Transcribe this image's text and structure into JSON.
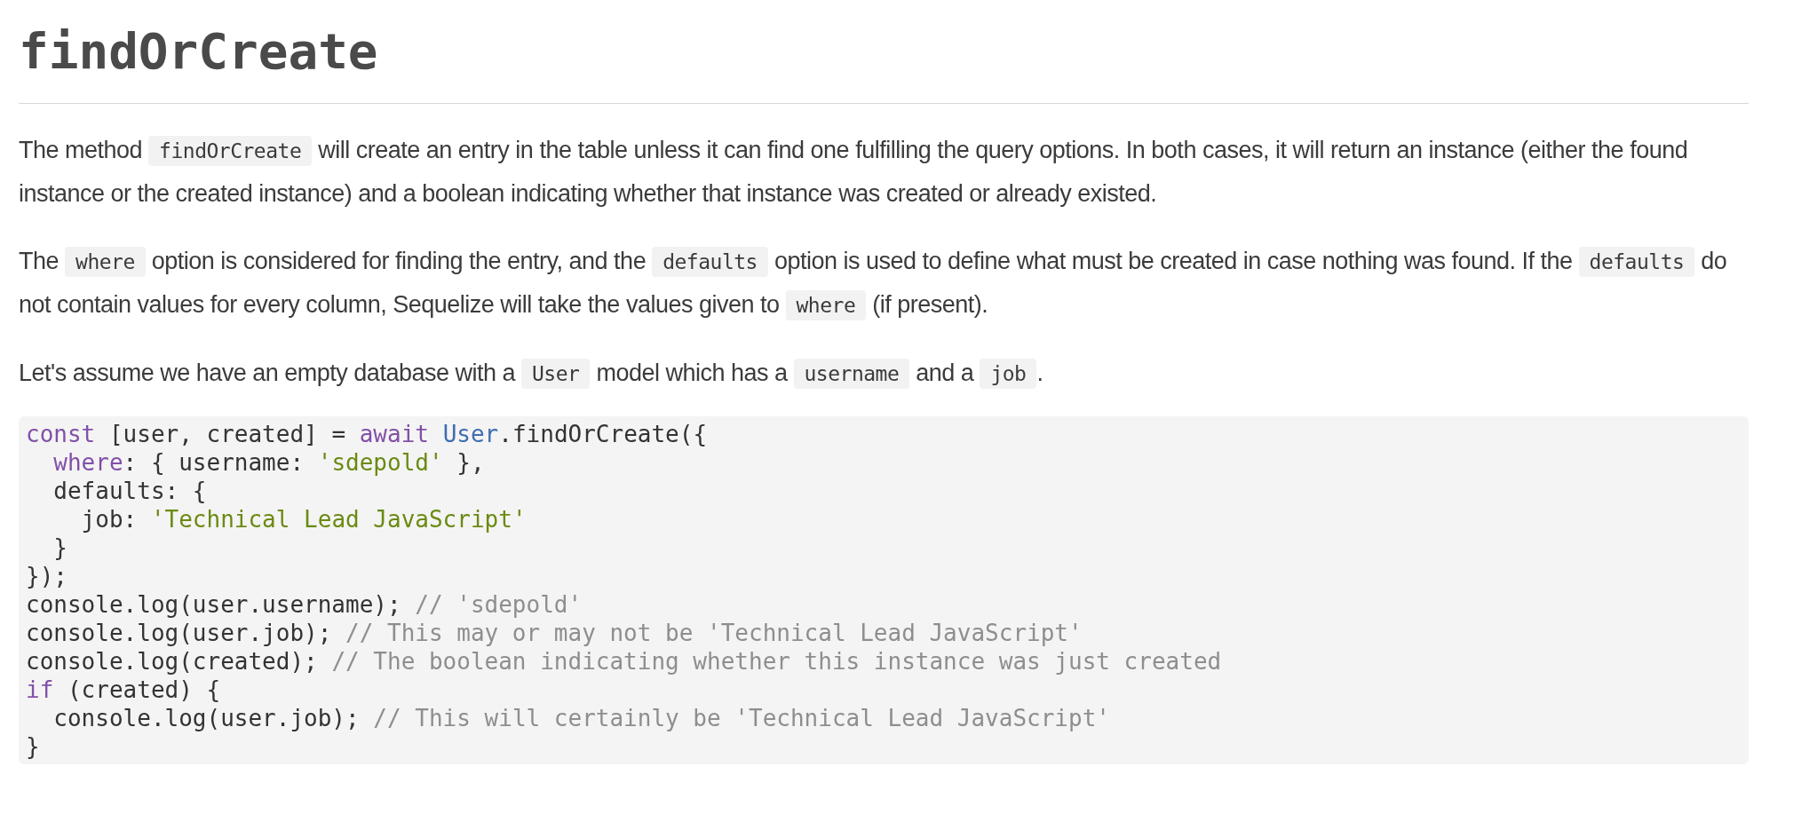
{
  "heading": "findOrCreate",
  "paragraphs": [
    [
      {
        "kind": "text",
        "text": "The method "
      },
      {
        "kind": "code",
        "text": "findOrCreate"
      },
      {
        "kind": "text",
        "text": " will create an entry in the table unless it can find one fulfilling the query options. In both cases, it will return an instance (either the found instance or the created instance) and a boolean indicating whether that instance was created or already existed."
      }
    ],
    [
      {
        "kind": "text",
        "text": "The "
      },
      {
        "kind": "code",
        "text": "where"
      },
      {
        "kind": "text",
        "text": " option is considered for finding the entry, and the "
      },
      {
        "kind": "code",
        "text": "defaults"
      },
      {
        "kind": "text",
        "text": " option is used to define what must be created in case nothing was found. If the "
      },
      {
        "kind": "code",
        "text": "defaults"
      },
      {
        "kind": "text",
        "text": " do not contain values for every column, Sequelize will take the values given to "
      },
      {
        "kind": "code",
        "text": "where"
      },
      {
        "kind": "text",
        "text": " (if present)."
      }
    ],
    [
      {
        "kind": "text",
        "text": "Let's assume we have an empty database with a "
      },
      {
        "kind": "code",
        "text": "User"
      },
      {
        "kind": "text",
        "text": " model which has a "
      },
      {
        "kind": "code",
        "text": "username"
      },
      {
        "kind": "text",
        "text": " and a "
      },
      {
        "kind": "code",
        "text": "job"
      },
      {
        "kind": "text",
        "text": "."
      }
    ]
  ],
  "code_lines": [
    [
      {
        "kind": "keyword",
        "text": "const"
      },
      {
        "kind": "plain",
        "text": " [user, created] = "
      },
      {
        "kind": "keyword",
        "text": "await"
      },
      {
        "kind": "class",
        "text": " User"
      },
      {
        "kind": "plain",
        "text": ".findOrCreate({"
      }
    ],
    [
      {
        "kind": "keyword",
        "text": "  where"
      },
      {
        "kind": "plain",
        "text": ": { username: "
      },
      {
        "kind": "string",
        "text": "'sdepold'"
      },
      {
        "kind": "plain",
        "text": " },"
      }
    ],
    [
      {
        "kind": "plain",
        "text": "  defaults: {"
      }
    ],
    [
      {
        "kind": "plain",
        "text": "    job: "
      },
      {
        "kind": "string",
        "text": "'Technical Lead JavaScript'"
      }
    ],
    [
      {
        "kind": "plain",
        "text": "  }"
      }
    ],
    [
      {
        "kind": "plain",
        "text": "});"
      }
    ],
    [
      {
        "kind": "plain",
        "text": "console.log(user.username); "
      },
      {
        "kind": "comment",
        "text": "// 'sdepold'"
      }
    ],
    [
      {
        "kind": "plain",
        "text": "console.log(user.job); "
      },
      {
        "kind": "comment",
        "text": "// This may or may not be 'Technical Lead JavaScript'"
      }
    ],
    [
      {
        "kind": "plain",
        "text": "console.log(created); "
      },
      {
        "kind": "comment",
        "text": "// The boolean indicating whether this instance was just created"
      }
    ],
    [
      {
        "kind": "keyword",
        "text": "if"
      },
      {
        "kind": "plain",
        "text": " (created) {"
      }
    ],
    [
      {
        "kind": "plain",
        "text": "  console.log(user.job); "
      },
      {
        "kind": "comment",
        "text": "// This will certainly be 'Technical Lead JavaScript'"
      }
    ],
    [
      {
        "kind": "plain",
        "text": "}"
      }
    ]
  ]
}
